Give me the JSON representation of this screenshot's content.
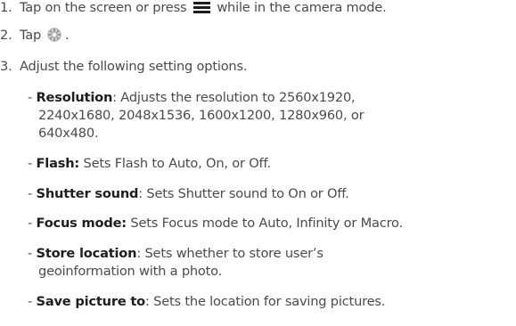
{
  "steps": [
    {
      "number": "1.",
      "text_before": "Tap on the screen or press",
      "text_after": "while in the camera mode."
    },
    {
      "number": "2.",
      "text_before": "Tap",
      "text_after": "."
    },
    {
      "number": "3.",
      "text": "Adjust the following setting options."
    }
  ],
  "icons": {
    "menu": "menu-icon",
    "settings": "gear-icon"
  },
  "options": [
    {
      "label": "Resolution",
      "desc_lines": [
        ": Adjusts the resolution to 2560x1920,",
        "2240x1680, 2048x1536, 1600x1200, 1280x960, or",
        "640x480."
      ]
    },
    {
      "label": "Flash:",
      "desc_lines": [
        " Sets Flash to Auto, On, or Off."
      ]
    },
    {
      "label": "Shutter sound",
      "desc_lines": [
        ": Sets Shutter sound to On or Off."
      ]
    },
    {
      "label": "Focus mode:",
      "desc_lines": [
        " Sets Focus mode to Auto, Infinity or Macro."
      ]
    },
    {
      "label": "Store location",
      "desc_lines": [
        ": Sets whether to store user’s",
        "geoinformation with a photo."
      ]
    },
    {
      "label": "Save picture to",
      "desc_lines": [
        ": Sets the location for saving pictures."
      ]
    }
  ],
  "bullet": "- "
}
